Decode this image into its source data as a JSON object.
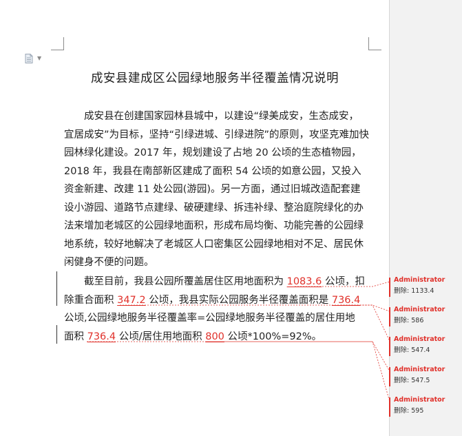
{
  "document": {
    "title": "成安县建成区公园绿地服务半径覆盖情况说明",
    "paragraph1_lines": [
      "　　成安县在创建国家园林县城中，以建设“绿美成安，生态成安，",
      "宜居成安”为目标，坚持“引绿进城、引绿进院”的原则，攻坚克难加快",
      "园林绿化建设。2017 年，规划建设了占地 20 公顷的生态植物园，",
      "2018 年，我县在南部新区建成了面积 54 公顷的如意公园，又投入",
      "资金新建、改建 11 处公园(游园)。另一方面，通过旧城改造配套建",
      "设小游园、道路节点建绿、破硬建绿、拆违补绿、整治庭院绿化的办",
      "法来增加老城区的公园绿地面积，形成布局均衡、功能完善的公园绿",
      "地系统，较好地解决了老城区人口密集区公园绿地相对不足、居民休",
      "闲健身不便的问题。"
    ],
    "paragraph2": {
      "l1_a": "　　截至目前，我县公园所覆盖居住区用地面积为 ",
      "l1_rev": "1083.6",
      "l1_b": " 公顷，扣",
      "l2_a": "除重合面积 ",
      "l2_rev1": "347.2",
      "l2_b": " 公顷，我县实际公园服务半径覆盖面积是 ",
      "l2_rev2": "736.4",
      "l3": "公顷,公园绿地服务半径覆盖率=公园绿地服务半径覆盖的居住用地",
      "l4_a": "面积 ",
      "l4_rev1": "736.4",
      "l4_b": " 公顷/居住用地面积 ",
      "l4_rev2": "800",
      "l4_c": " 公顷*100%=92%。"
    }
  },
  "markup": {
    "comments": [
      {
        "author": "Administrator",
        "label": "删除:",
        "value": "1133.4"
      },
      {
        "author": "Administrator",
        "label": "删除:",
        "value": "586"
      },
      {
        "author": "Administrator",
        "label": "删除:",
        "value": "547.4"
      },
      {
        "author": "Administrator",
        "label": "删除:",
        "value": "547.5"
      },
      {
        "author": "Administrator",
        "label": "删除:",
        "value": "595"
      }
    ]
  },
  "colors": {
    "revision": "#e0302a",
    "markup_pane": "#f2f2f2",
    "text": "#222222"
  },
  "icons": [
    "document-icon",
    "dropdown-caret-icon"
  ]
}
